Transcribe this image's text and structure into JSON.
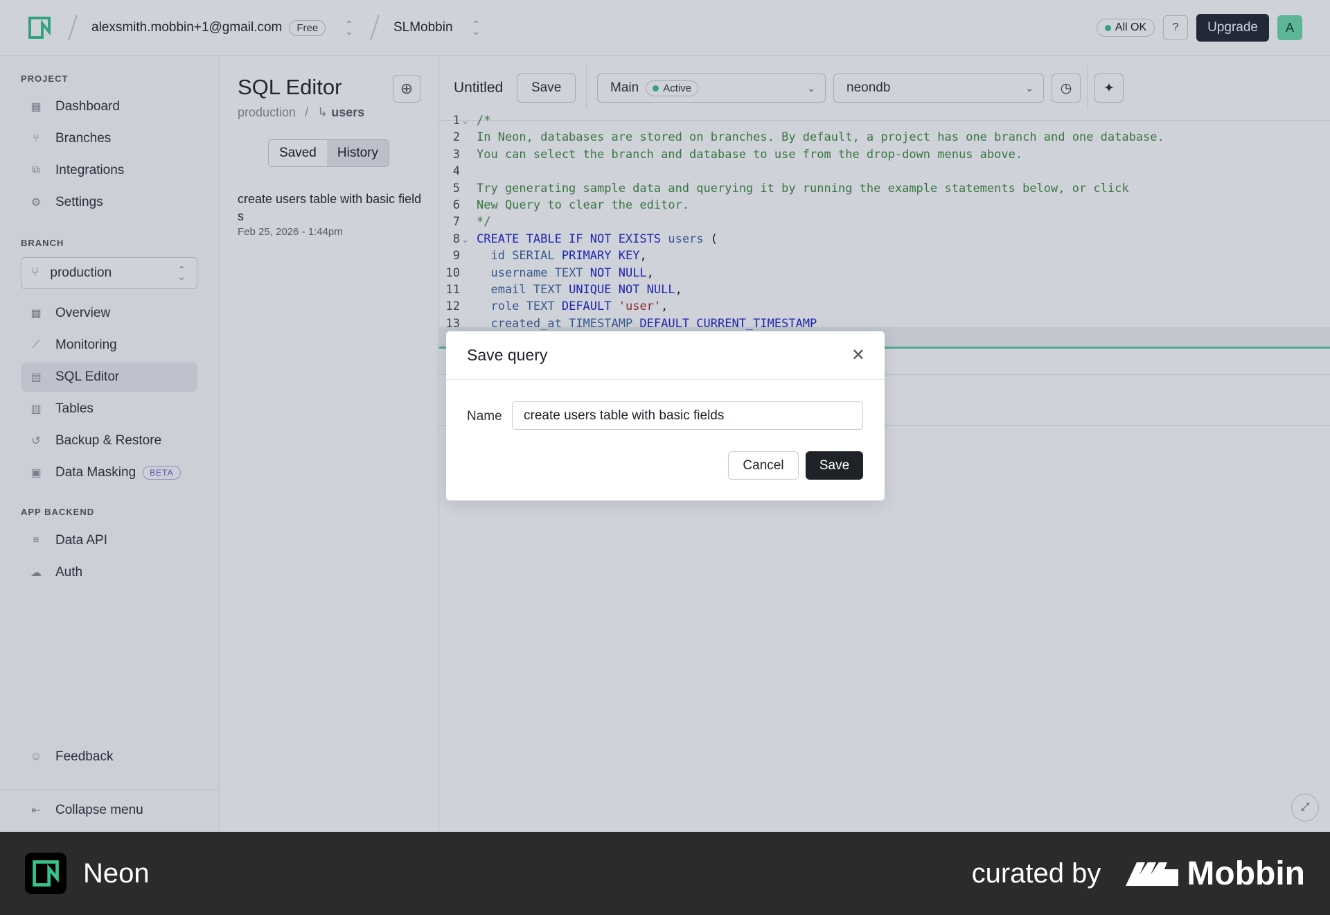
{
  "topbar": {
    "account_email": "alexsmith.mobbin+1@gmail.com",
    "plan_badge": "Free",
    "project_name": "SLMobbin",
    "status_label": "All OK",
    "upgrade_label": "Upgrade",
    "avatar_initial": "A"
  },
  "sidebar": {
    "project_section": "PROJECT",
    "project_items": [
      {
        "label": "Dashboard",
        "icon": "grid-icon"
      },
      {
        "label": "Branches",
        "icon": "branch-icon"
      },
      {
        "label": "Integrations",
        "icon": "plug-icon"
      },
      {
        "label": "Settings",
        "icon": "gear-icon"
      }
    ],
    "branch_section": "BRANCH",
    "branch_selected": "production",
    "branch_items": [
      {
        "label": "Overview",
        "icon": "grid-icon"
      },
      {
        "label": "Monitoring",
        "icon": "chart-icon"
      },
      {
        "label": "SQL Editor",
        "icon": "terminal-icon",
        "active": true
      },
      {
        "label": "Tables",
        "icon": "table-icon"
      },
      {
        "label": "Backup & Restore",
        "icon": "history-icon"
      },
      {
        "label": "Data Masking",
        "icon": "mask-icon",
        "badge": "BETA"
      }
    ],
    "backend_section": "APP BACKEND",
    "backend_items": [
      {
        "label": "Data API",
        "icon": "api-icon"
      },
      {
        "label": "Auth",
        "icon": "cloud-lock-icon"
      }
    ],
    "feedback_label": "Feedback",
    "collapse_label": "Collapse menu"
  },
  "midpanel": {
    "title": "SQL Editor",
    "breadcrumb_branch": "production",
    "breadcrumb_sep": "/",
    "breadcrumb_table": "users",
    "tab_saved": "Saved",
    "tab_history": "History",
    "history_item_title": "create users table with basic fields",
    "history_item_date": "Feb 25, 2026 - 1:44pm"
  },
  "editor": {
    "query_title": "Untitled",
    "save_label": "Save",
    "branch_select": "Main",
    "branch_status": "Active",
    "database_select": "neondb"
  },
  "code_lines": [
    {
      "n": "1",
      "fold": true,
      "parts": [
        {
          "c": "cm",
          "t": "/*"
        }
      ]
    },
    {
      "n": "2",
      "parts": [
        {
          "c": "cm",
          "t": "In Neon, databases are stored on branches. By default, a project has one branch and one database."
        }
      ]
    },
    {
      "n": "3",
      "parts": [
        {
          "c": "cm",
          "t": "You can select the branch and database to use from the drop-down menus above."
        }
      ]
    },
    {
      "n": "4",
      "parts": []
    },
    {
      "n": "5",
      "parts": [
        {
          "c": "cm",
          "t": "Try generating sample data and querying it by running the example statements below, or click"
        }
      ]
    },
    {
      "n": "6",
      "parts": [
        {
          "c": "cm",
          "t": "New Query to clear the editor."
        }
      ]
    },
    {
      "n": "7",
      "parts": [
        {
          "c": "cm",
          "t": "*/"
        }
      ]
    },
    {
      "n": "8",
      "fold": true,
      "parts": [
        {
          "c": "kw",
          "t": "CREATE TABLE IF NOT EXISTS "
        },
        {
          "c": "ty",
          "t": "users"
        },
        {
          "c": "",
          "t": " ("
        }
      ]
    },
    {
      "n": "9",
      "parts": [
        {
          "c": "ty",
          "t": "  id "
        },
        {
          "c": "ty",
          "t": "SERIAL "
        },
        {
          "c": "kw",
          "t": "PRIMARY KEY"
        },
        {
          "c": "",
          "t": ","
        }
      ]
    },
    {
      "n": "10",
      "parts": [
        {
          "c": "ty",
          "t": "  username "
        },
        {
          "c": "ty",
          "t": "TEXT "
        },
        {
          "c": "kw",
          "t": "NOT NULL"
        },
        {
          "c": "",
          "t": ","
        }
      ]
    },
    {
      "n": "11",
      "parts": [
        {
          "c": "ty",
          "t": "  email "
        },
        {
          "c": "ty",
          "t": "TEXT "
        },
        {
          "c": "kw",
          "t": "UNIQUE NOT NULL"
        },
        {
          "c": "",
          "t": ","
        }
      ]
    },
    {
      "n": "12",
      "parts": [
        {
          "c": "ty",
          "t": "  role "
        },
        {
          "c": "ty",
          "t": "TEXT "
        },
        {
          "c": "kw",
          "t": "DEFAULT "
        },
        {
          "c": "st",
          "t": "'user'"
        },
        {
          "c": "",
          "t": ","
        }
      ]
    },
    {
      "n": "13",
      "parts": [
        {
          "c": "ty",
          "t": "  created_at "
        },
        {
          "c": "ty",
          "t": "TIMESTAMP "
        },
        {
          "c": "kw",
          "t": "DEFAULT CURRENT_TIMESTAMP"
        }
      ]
    }
  ],
  "modal": {
    "title": "Save query",
    "name_label": "Name",
    "name_value": "create users table with basic fields",
    "cancel_label": "Cancel",
    "save_label": "Save"
  },
  "footer": {
    "app_name": "Neon",
    "curated_by": "curated by",
    "brand": "Mobbin"
  },
  "colors": {
    "accent": "#37c38a",
    "beta": "#6e53c7",
    "primary_button": "#1f2226"
  }
}
